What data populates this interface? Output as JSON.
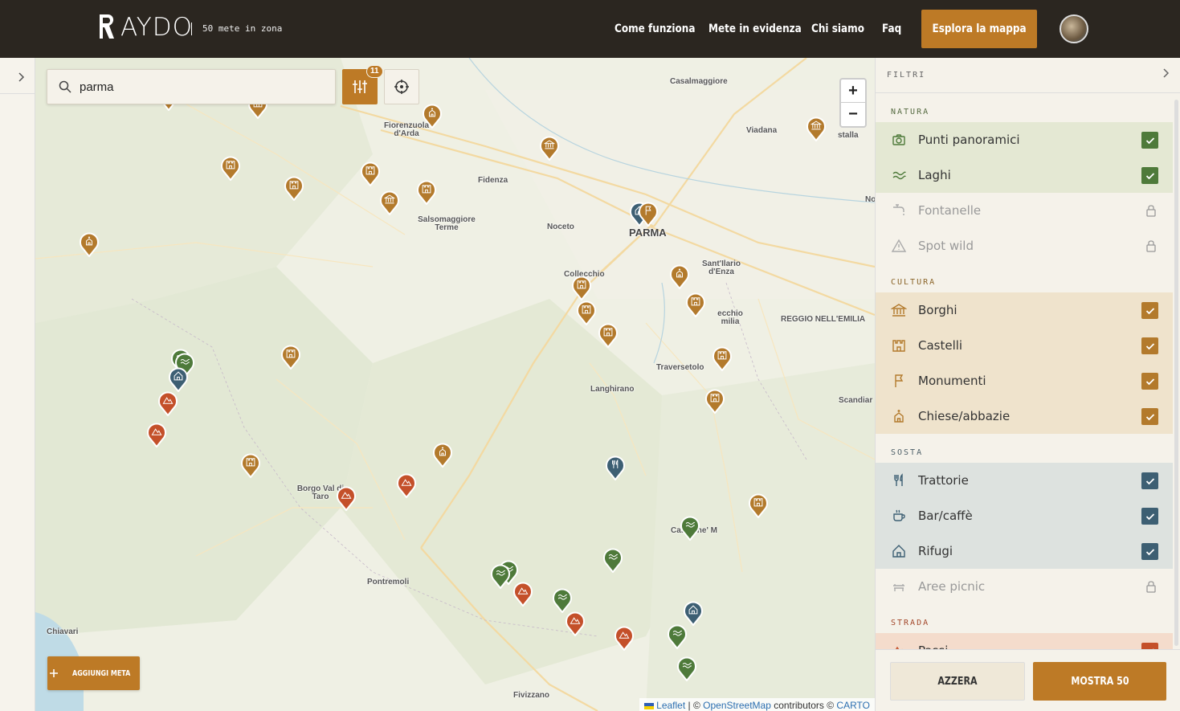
{
  "header": {
    "logo_text": "AYDO",
    "tagline": "50 mete in zona",
    "nav": [
      "Come funziona",
      "Mete in evidenza",
      "Chi siamo",
      "Faq"
    ],
    "cta": "Esplora la mappa"
  },
  "map": {
    "search_value": "parma",
    "filter_count": "11",
    "zoom_in": "+",
    "zoom_out": "−",
    "add_button": "AGGIUNGI META",
    "attribution": {
      "leaflet": "Leaflet",
      "sep": " | © ",
      "osm": "OpenStreetMap",
      "mid": " contributors © ",
      "carto": "CARTO"
    },
    "places": {
      "casalmaggiore": "Casalmaggiore",
      "fiorenzuola": "Fiorenzuola d'Arda",
      "viadana": "Viadana",
      "guastalla": "stalla",
      "fidenza": "Fidenza",
      "salso": "Salsomaggiore Terme",
      "noceto": "Noceto",
      "parma": "PARMA",
      "no": "No",
      "santilario": "Sant'Ilario d'Enza",
      "collecchio": "Collecchio",
      "montecchio": "ecchio milia",
      "reggio": "REGGIO NELL'EMILIA",
      "traversetolo": "Traversetolo",
      "langhirano": "Langhirano",
      "scandiano": "Scandiar",
      "borgo": "Borgo Val di Taro",
      "castelnovo": "Castel ne' M",
      "pontremoli": "Pontremoli",
      "chiavari": "Chiavari",
      "fivizzano": "Fivizzano"
    }
  },
  "filters": {
    "title": "FILTRI",
    "sections": {
      "natura": "NATURA",
      "cultura": "CULTURA",
      "sosta": "SOSTA",
      "strada": "STRADA"
    },
    "natura": [
      {
        "label": "Punti panoramici",
        "icon": "camera-icon",
        "state": "checked"
      },
      {
        "label": "Laghi",
        "icon": "waves-icon",
        "state": "checked"
      },
      {
        "label": "Fontanelle",
        "icon": "faucet-icon",
        "state": "locked"
      },
      {
        "label": "Spot wild",
        "icon": "warning-triangle-icon",
        "state": "locked"
      }
    ],
    "cultura": [
      {
        "label": "Borghi",
        "icon": "bank-icon",
        "state": "checked"
      },
      {
        "label": "Castelli",
        "icon": "castle-icon",
        "state": "checked"
      },
      {
        "label": "Monumenti",
        "icon": "flag-icon",
        "state": "checked"
      },
      {
        "label": "Chiese/abbazie",
        "icon": "church-icon",
        "state": "checked"
      }
    ],
    "sosta": [
      {
        "label": "Trattorie",
        "icon": "cutlery-icon",
        "state": "checked"
      },
      {
        "label": "Bar/caffè",
        "icon": "coffee-icon",
        "state": "checked"
      },
      {
        "label": "Rifugi",
        "icon": "house-icon",
        "state": "checked"
      },
      {
        "label": "Aree picnic",
        "icon": "bench-icon",
        "state": "locked"
      }
    ],
    "strada": [
      {
        "label": "Passi",
        "icon": "mountain-icon",
        "state": "checked"
      }
    ],
    "reset": "AZZERA",
    "show": "MOSTRA 50"
  },
  "colors": {
    "accent": "#bd7a26",
    "header_bg": "#2b2620",
    "natura": "#4e7a3a",
    "cultura": "#b37a2c",
    "sosta": "#3d5f73",
    "strada": "#c4502a"
  }
}
